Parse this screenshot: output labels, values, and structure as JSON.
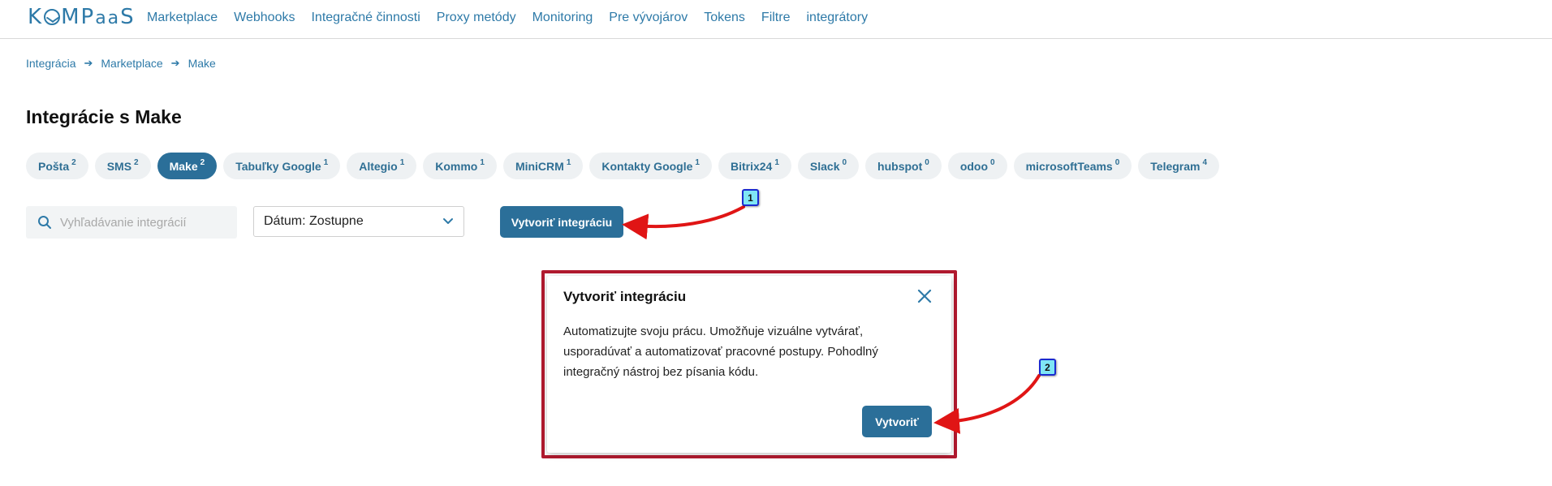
{
  "brand": {
    "logo": "KOMPaaS"
  },
  "nav": {
    "items": [
      "Marketplace",
      "Webhooks",
      "Integračné činnosti",
      "Proxy metódy",
      "Monitoring",
      "Pre vývojárov",
      "Tokens",
      "Filtre",
      "integrátory"
    ]
  },
  "breadcrumb": [
    "Integrácia",
    "Marketplace",
    "Make"
  ],
  "page": {
    "title": "Integrácie s Make"
  },
  "tabs": [
    {
      "label": "Pošta",
      "count": "2"
    },
    {
      "label": "SMS",
      "count": "2"
    },
    {
      "label": "Make",
      "count": "2",
      "active": true
    },
    {
      "label": "Tabuľky Google",
      "count": "1"
    },
    {
      "label": "Altegio",
      "count": "1"
    },
    {
      "label": "Kommo",
      "count": "1"
    },
    {
      "label": "MiniCRM",
      "count": "1"
    },
    {
      "label": "Kontakty Google",
      "count": "1"
    },
    {
      "label": "Bitrix24",
      "count": "1"
    },
    {
      "label": "Slack",
      "count": "0"
    },
    {
      "label": "hubspot",
      "count": "0"
    },
    {
      "label": "odoo",
      "count": "0"
    },
    {
      "label": "microsoftTeams",
      "count": "0"
    },
    {
      "label": "Telegram",
      "count": "4"
    }
  ],
  "search": {
    "placeholder": "Vyhľadávanie integrácií",
    "value": ""
  },
  "sort": {
    "selected": "Dátum: Zostupne"
  },
  "toolbar": {
    "create_label": "Vytvoriť integráciu"
  },
  "modal": {
    "title": "Vytvoriť integráciu",
    "body": "Automatizujte svoju prácu. Umožňuje vizuálne vytvárať, usporadúvať a automatizovať pracovné postupy. Pohodlný integračný nástroj bez písania kódu.",
    "confirm_label": "Vytvoriť"
  },
  "annotations": {
    "badge1": "1",
    "badge2": "2"
  },
  "colors": {
    "primary": "#2b6f99",
    "link": "#2e7aa8",
    "tab_bg": "#eef1f3",
    "highlight": "#b11a2f",
    "arrow": "#e01515",
    "badge": "#7fe6f5"
  },
  "icons": {
    "search": "search-icon",
    "chevron": "chevron-down-icon",
    "close": "close-icon",
    "breadcrumb_sep": "arrow-right-icon"
  }
}
